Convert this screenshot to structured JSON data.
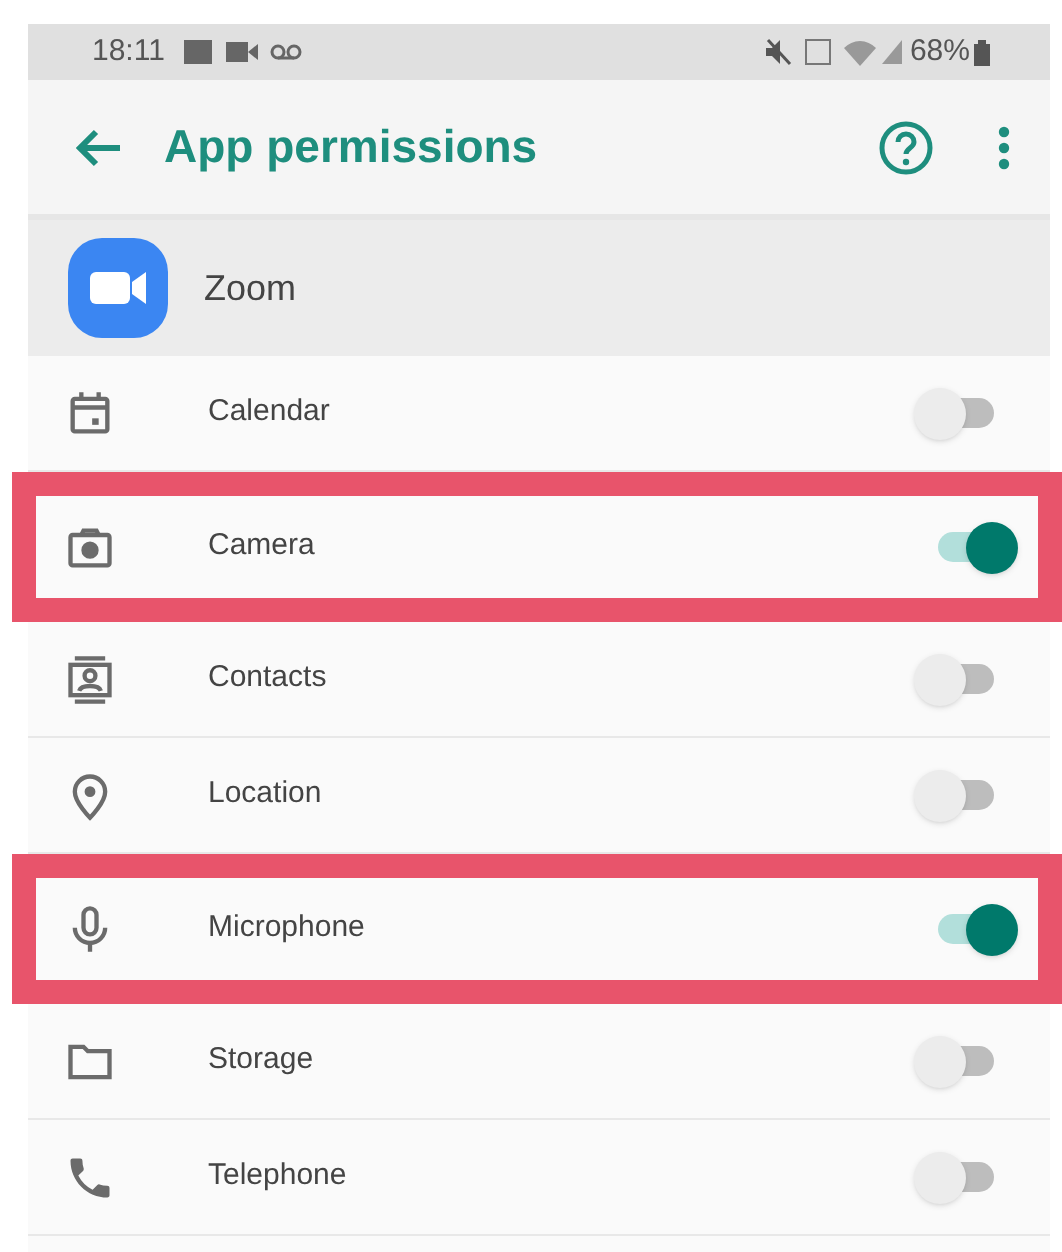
{
  "status_bar": {
    "time": "18:11",
    "battery": "68%"
  },
  "header": {
    "title": "App permissions"
  },
  "app": {
    "name": "Zoom"
  },
  "permissions": [
    {
      "label": "Calendar",
      "on": false,
      "highlighted": false
    },
    {
      "label": "Camera",
      "on": true,
      "highlighted": true
    },
    {
      "label": "Contacts",
      "on": false,
      "highlighted": false
    },
    {
      "label": "Location",
      "on": false,
      "highlighted": false
    },
    {
      "label": "Microphone",
      "on": true,
      "highlighted": true
    },
    {
      "label": "Storage",
      "on": false,
      "highlighted": false
    },
    {
      "label": "Telephone",
      "on": false,
      "highlighted": false
    }
  ]
}
